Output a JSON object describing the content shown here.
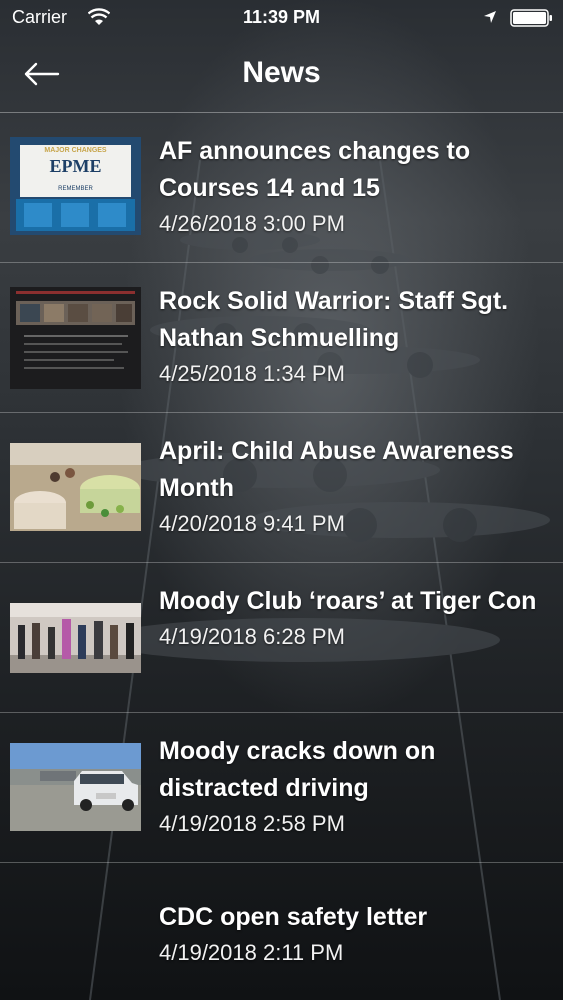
{
  "status_bar": {
    "carrier": "Carrier",
    "time": "11:39 PM"
  },
  "nav": {
    "title": "News",
    "back_icon": "back-arrow-icon"
  },
  "news": [
    {
      "title": "AF announces changes to Courses 14 and 15",
      "date": "4/26/2018 3:00 PM",
      "thumbnail_text": [
        "MAJOR CHANGES",
        "EPME",
        "REMEMBER"
      ]
    },
    {
      "title": "Rock Solid Warrior: Staff Sgt. Nathan Schmuelling",
      "date": "4/25/2018 1:34 PM"
    },
    {
      "title": "April: Child Abuse Awareness Month",
      "date": "4/20/2018 9:41 PM"
    },
    {
      "title": "Moody Club ‘roars’ at Tiger Con",
      "date": "4/19/2018 6:28 PM"
    },
    {
      "title": "Moody cracks down on distracted driving",
      "date": "4/19/2018 2:58 PM"
    },
    {
      "title": "CDC open safety letter",
      "date": "4/19/2018 2:11 PM"
    }
  ],
  "colors": {
    "text": "#ffffff",
    "divider": "rgba(255,255,255,0.3)",
    "background": "#1a1d20"
  }
}
